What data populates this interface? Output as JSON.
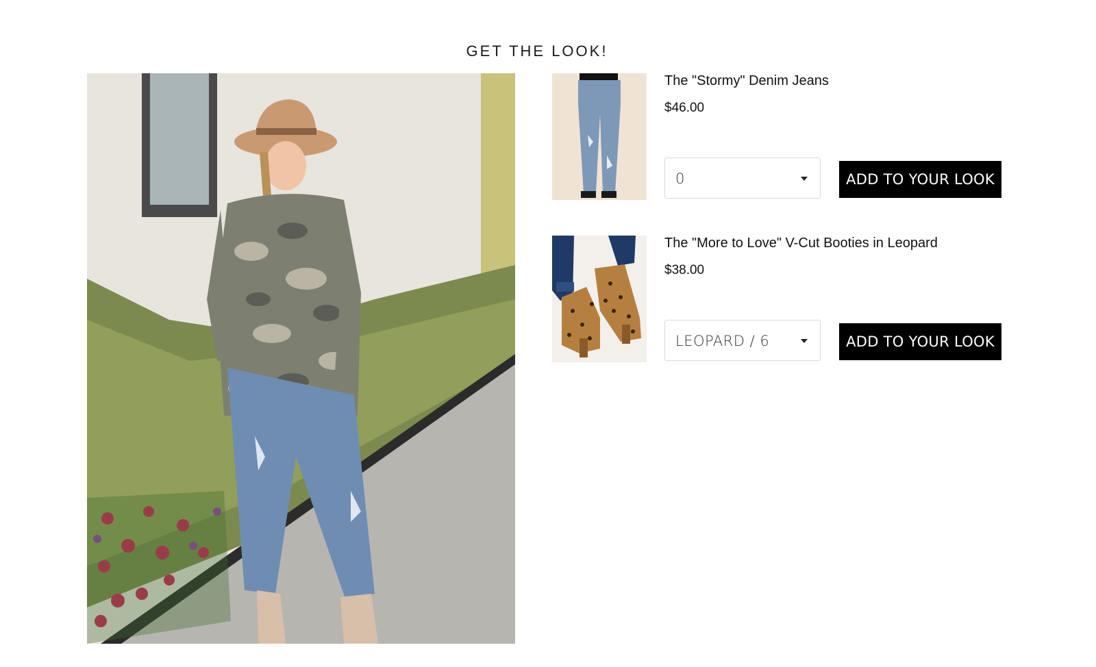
{
  "section": {
    "title": "GET THE LOOK!"
  },
  "hero": {
    "image": "model-in-camo-top-and-jeans-photo"
  },
  "products": [
    {
      "name": "The \"Stormy\" Denim Jeans",
      "price": "$46.00",
      "thumbnail": "distressed-jeans-photo",
      "selected_variant": "0",
      "button_label": "ADD TO YOUR LOOK"
    },
    {
      "name": "The \"More to Love\" V-Cut Booties in Leopard",
      "price": "$38.00",
      "thumbnail": "leopard-booties-photo",
      "selected_variant": "LEOPARD / 6",
      "button_label": "ADD TO YOUR LOOK"
    }
  ],
  "colors": {
    "button_bg": "#000000",
    "button_text": "#ffffff",
    "select_border": "#d8d8d8"
  }
}
